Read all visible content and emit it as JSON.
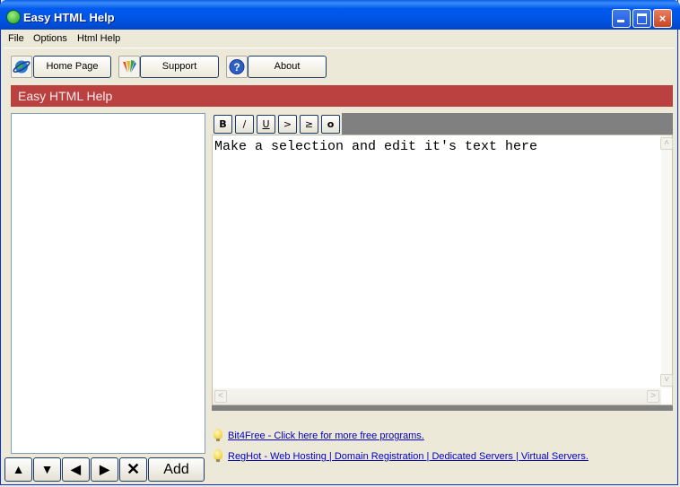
{
  "window": {
    "title": "Easy HTML Help",
    "controls": {
      "minimize": "minimize",
      "maximize": "maximize",
      "close": "×"
    }
  },
  "menu": [
    "File",
    "Options",
    "Html Help"
  ],
  "toolbar": {
    "home_label": "Home Page",
    "support_label": "Support",
    "about_label": "About"
  },
  "banner": {
    "title": "Easy HTML Help"
  },
  "formatting": {
    "bold": "B",
    "italic": "/",
    "underline": "U",
    "greater": ">",
    "greater_equal": "≥",
    "other": "o"
  },
  "editor": {
    "text": "Make a selection and edit it's text here"
  },
  "scrollbar_glyphs": {
    "up": "˄",
    "down": "˅",
    "left": "<",
    "right": ">"
  },
  "nav": {
    "up": "▲",
    "down": "▼",
    "left": "◀",
    "right": "▶",
    "delete": "✕",
    "add_label": "Add"
  },
  "links": [
    "Bit4Free - Click here for more free programs.",
    "RegHot - Web Hosting | Domain Registration | Dedicated Servers | Virtual Servers."
  ],
  "colors": {
    "banner": "#bb4040",
    "titlebar": "#0054e3",
    "link": "#0000c0",
    "face": "#ece9d8"
  }
}
